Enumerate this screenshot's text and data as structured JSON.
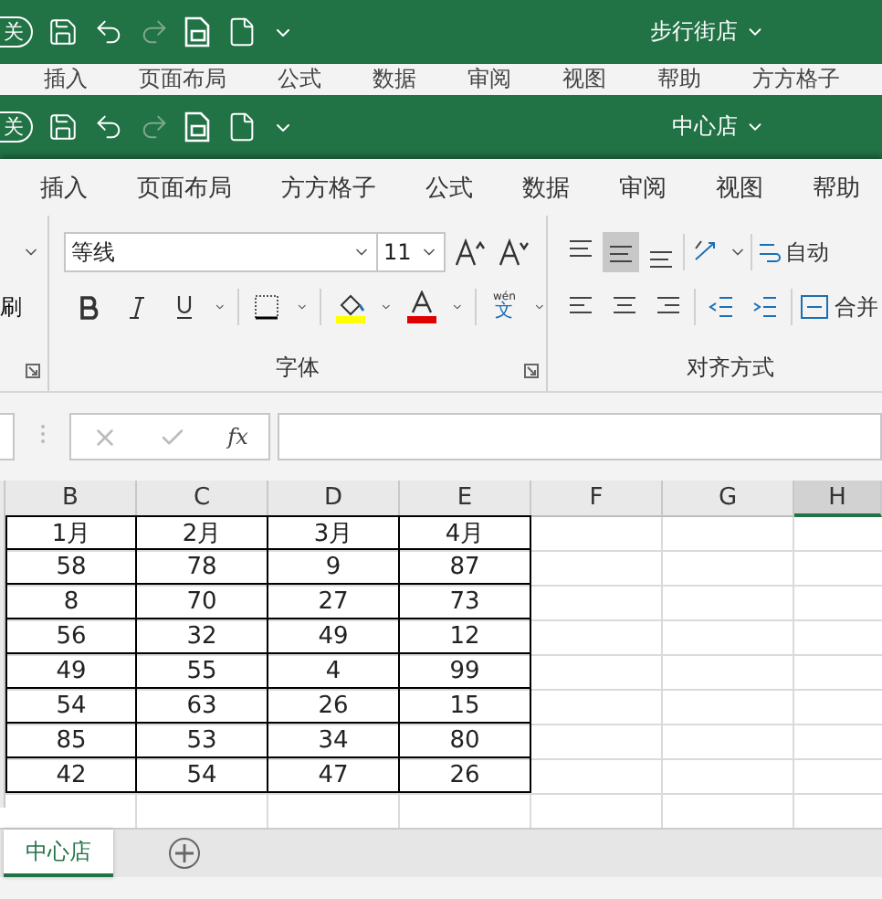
{
  "back_window": {
    "autosave_label": "关",
    "title": "步行街店",
    "tabs": [
      "插入",
      "页面布局",
      "公式",
      "数据",
      "审阅",
      "视图",
      "帮助",
      "方方格子"
    ]
  },
  "window": {
    "autosave_label": "关",
    "title": "中心店"
  },
  "ribbon_tabs": [
    "插入",
    "页面布局",
    "方方格子",
    "公式",
    "数据",
    "审阅",
    "视图",
    "帮助"
  ],
  "clipboard": {
    "label_fragment": "刷"
  },
  "font": {
    "name": "等线",
    "size": "11",
    "group_label": "字体",
    "phonetic_top": "wén",
    "phonetic_bottom": "文",
    "color_buttons": [
      {
        "kind": "fill",
        "color": "#ffff00"
      },
      {
        "kind": "text",
        "color": "#e00000"
      }
    ]
  },
  "alignment": {
    "group_label": "对齐方式",
    "wrap_label": "自动",
    "merge_label": "合并",
    "vertical": [
      {
        "kind": "top",
        "selected": false
      },
      {
        "kind": "middle",
        "selected": true
      },
      {
        "kind": "bottom",
        "selected": false
      }
    ]
  },
  "formula_bar": {
    "function_label": "fx"
  },
  "sheet": {
    "columns": [
      {
        "label": "B",
        "selected": false
      },
      {
        "label": "C",
        "selected": false
      },
      {
        "label": "D",
        "selected": false
      },
      {
        "label": "E",
        "selected": false
      },
      {
        "label": "F",
        "selected": false
      },
      {
        "label": "G",
        "selected": false
      },
      {
        "label": "H",
        "selected": true
      }
    ],
    "rows": [
      [
        "1月",
        "2月",
        "3月",
        "4月"
      ],
      [
        "58",
        "78",
        "9",
        "87"
      ],
      [
        "8",
        "70",
        "27",
        "73"
      ],
      [
        "56",
        "32",
        "49",
        "12"
      ],
      [
        "49",
        "55",
        "4",
        "99"
      ],
      [
        "54",
        "63",
        "26",
        "15"
      ],
      [
        "85",
        "53",
        "34",
        "80"
      ],
      [
        "42",
        "54",
        "47",
        "26"
      ]
    ]
  },
  "sheet_tabs": [
    {
      "label": "中心店",
      "selected": true
    }
  ]
}
